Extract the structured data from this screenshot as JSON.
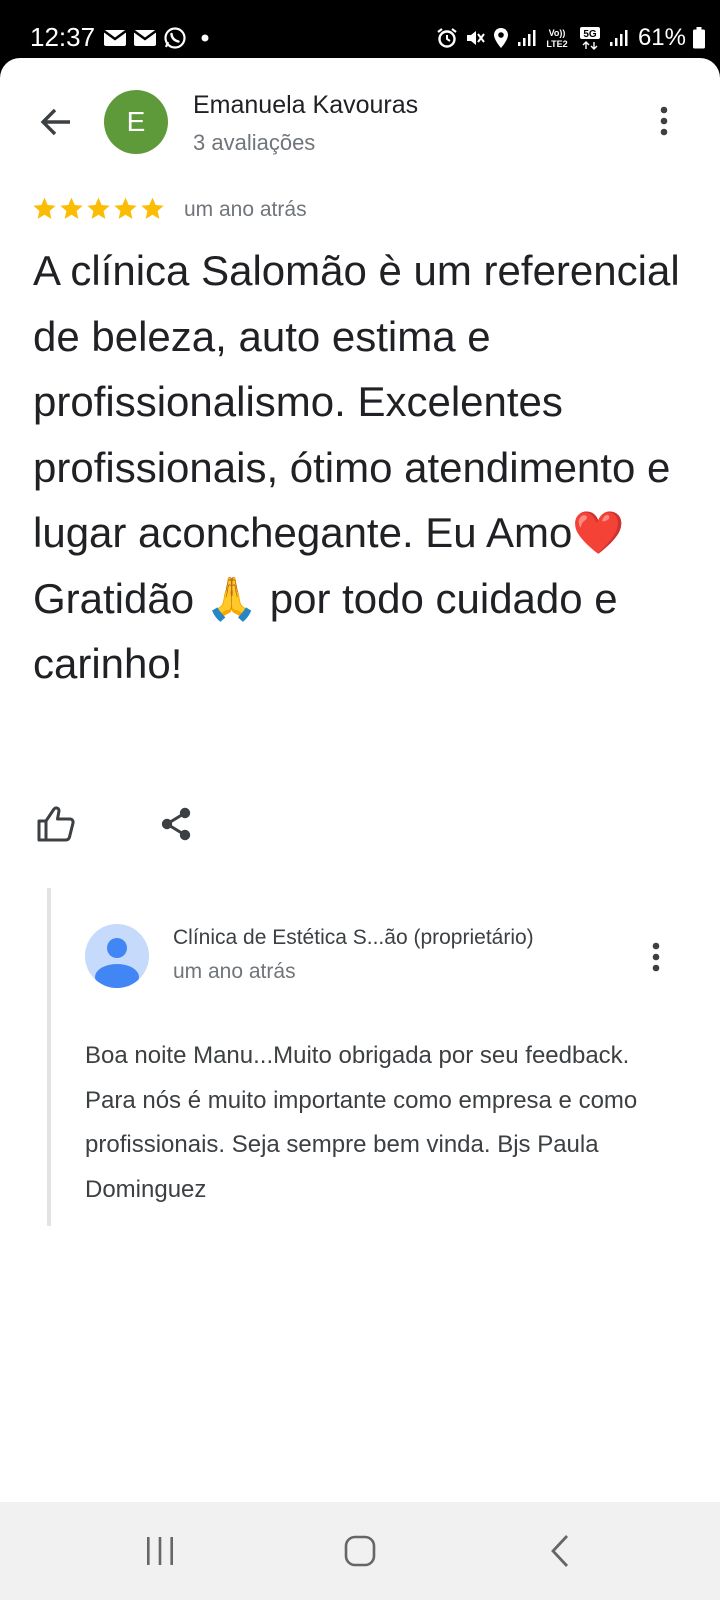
{
  "status_bar": {
    "time": "12:37",
    "battery": "61%",
    "left_icons": [
      "gmail-icon",
      "gmail-icon",
      "whatsapp-icon",
      "dot-icon"
    ],
    "right_icons": [
      "alarm-icon",
      "mute-icon",
      "location-icon",
      "signal-icon",
      "volte-icon",
      "5g-icon",
      "signal-icon",
      "battery-icon"
    ],
    "volte_label": "Vo)) LTE2",
    "network_label": "5G"
  },
  "header": {
    "back_icon": "arrow-back-icon",
    "avatar_letter": "E",
    "avatar_color": "#5e9a3a",
    "reviewer_name": "Emanuela Kavouras",
    "review_count": "3 avaliações",
    "more_icon": "more-vert-icon"
  },
  "review": {
    "rating": 5,
    "max_rating": 5,
    "star_color": "#fbbc04",
    "date": "um ano atrás",
    "text": "A clínica Salomão è um referencial de beleza, auto estima e profissionalismo. Excelentes profissionais, ótimo atendimento e lugar aconchegante. Eu Amo❤️ Gratidão 🙏 por todo cuidado e carinho!",
    "like_icon": "thumb-up-icon",
    "share_icon": "share-icon"
  },
  "owner_reply": {
    "name": "Clínica de Estética S...ão (proprietário)",
    "date": "um ano atrás",
    "text": "Boa noite Manu...Muito obrigada por seu feedback.  Para nós é muito importante como empresa e como profissionais.  Seja sempre bem vinda.  Bjs Paula Dominguez",
    "avatar_icon": "person-icon",
    "more_icon": "more-vert-icon"
  },
  "nav_bar": {
    "recents_icon": "recents-icon",
    "home_icon": "home-icon",
    "back_icon": "back-icon"
  }
}
